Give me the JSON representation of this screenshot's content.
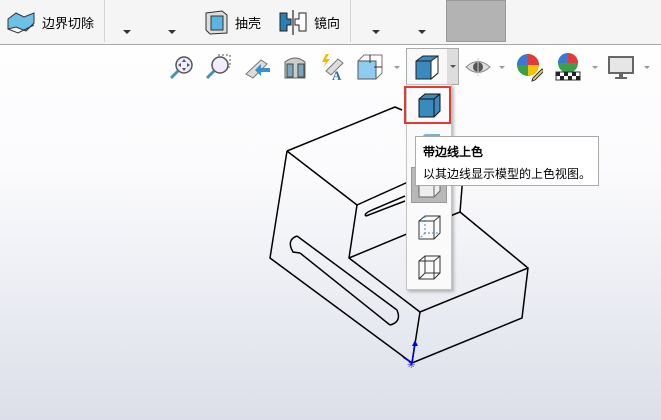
{
  "toolbar": {
    "boundary_cut": "边界切除",
    "shell": "抽壳",
    "mirror": "镜向"
  },
  "view_toolbar": {
    "icons": [
      "zoom-to-fit-icon",
      "zoom-to-area-icon",
      "previous-view-icon",
      "section-view-icon",
      "dynamic-annotation-views-icon",
      "view-orientation-icon",
      "display-style-icon",
      "hide-show-items-icon",
      "edit-appearance-icon",
      "apply-scene-icon",
      "view-settings-icon"
    ]
  },
  "display_style_menu": {
    "items": [
      "shaded-with-edges",
      "shaded",
      "hidden-lines-removed",
      "hidden-lines-visible",
      "wireframe"
    ],
    "selected": "shaded-with-edges",
    "highlight_color": "#e53935"
  },
  "tooltip": {
    "title": "带边线上色",
    "description": "以其边线显示模型的上色视图。"
  }
}
